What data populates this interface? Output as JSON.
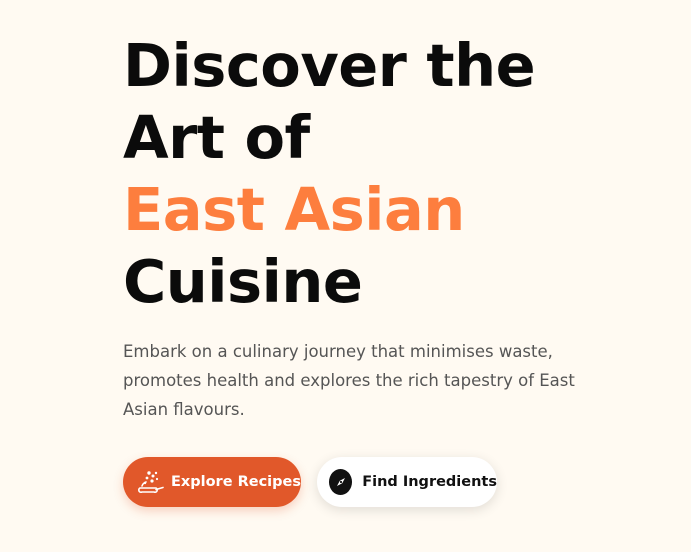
{
  "hero": {
    "headline": {
      "line1": "Discover the",
      "line2": "Art of",
      "accent": "East Asian",
      "line4": "Cuisine"
    },
    "subtitle": "Embark on a culinary journey that minimises waste, promotes health and explores the rich tapestry of East Asian flavours.",
    "primary_button": {
      "label": "Explore Recipes",
      "icon": "cooking-pan-icon"
    },
    "secondary_button": {
      "label": "Find Ingredients",
      "icon": "compass-icon"
    }
  },
  "colors": {
    "background": "#fffaf2",
    "headline": "#0b0b0b",
    "accent": "#fd7e3e",
    "subtitle": "#555555",
    "primary_button": "#e1582a",
    "secondary_button": "#ffffff"
  }
}
